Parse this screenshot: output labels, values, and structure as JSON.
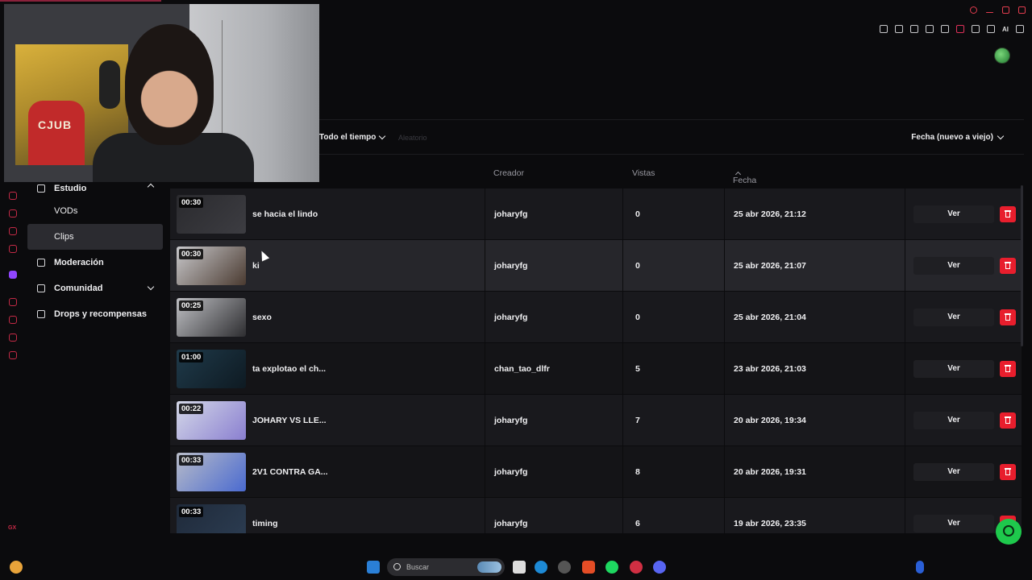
{
  "filters": {
    "date_range": "Todo el tiempo",
    "faded": "Aleatorio",
    "sort": "Fecha (nuevo a viejo)"
  },
  "nav": {
    "items": [
      {
        "label": "Estudio",
        "expanded": true
      },
      {
        "label": "VODs"
      },
      {
        "label": "Clips",
        "active": true
      },
      {
        "label": "Moderación"
      },
      {
        "label": "Comunidad",
        "expanded": false
      },
      {
        "label": "Drops y recompensas"
      }
    ]
  },
  "table": {
    "headers": {
      "creator": "Creador",
      "views": "Vistas",
      "date": "Fecha"
    },
    "rows": [
      {
        "duration": "00:30",
        "title": "se hacia el lindo",
        "creator": "joharyfg",
        "views": "0",
        "date": "25 abr 2026, 21:12",
        "action": "Ver",
        "thumb": [
          "#2a2a2e",
          "#3d3d42"
        ]
      },
      {
        "duration": "00:30",
        "title": "ki",
        "creator": "joharyfg",
        "views": "0",
        "date": "25 abr 2026, 21:07",
        "action": "Ver",
        "thumb": [
          "#c9c9cc",
          "#4a3a30"
        ]
      },
      {
        "duration": "00:25",
        "title": "sexo",
        "creator": "joharyfg",
        "views": "0",
        "date": "25 abr 2026, 21:04",
        "action": "Ver",
        "thumb": [
          "#bfc0c4",
          "#2d2d30"
        ]
      },
      {
        "duration": "01:00",
        "title": "ta explotao el ch...",
        "creator": "chan_tao_dlfr",
        "views": "5",
        "date": "23 abr 2026, 21:03",
        "action": "Ver",
        "thumb": [
          "#1f3a4a",
          "#0e1a22"
        ]
      },
      {
        "duration": "00:22",
        "title": "JOHARY VS LLE...",
        "creator": "joharyfg",
        "views": "7",
        "date": "20 abr 2026, 19:34",
        "action": "Ver",
        "thumb": [
          "#d4d8e8",
          "#8a7fd0"
        ]
      },
      {
        "duration": "00:33",
        "title": "2V1 CONTRA GA...",
        "creator": "joharyfg",
        "views": "8",
        "date": "20 abr 2026, 19:31",
        "action": "Ver",
        "thumb": [
          "#b8bcc8",
          "#4a6ad0"
        ]
      },
      {
        "duration": "00:33",
        "title": "timing",
        "creator": "joharyfg",
        "views": "6",
        "date": "19 abr 2026, 23:35",
        "action": "Ver",
        "thumb": [
          "#1f2a3a",
          "#2c3d52"
        ]
      }
    ]
  },
  "webcam": {
    "jersey_text": "CJUB"
  },
  "toolbar": {
    "ai_label": "AI"
  },
  "taskbar": {
    "search_placeholder": "Buscar"
  },
  "colors": {
    "accent": "#e0315a",
    "danger": "#e81e2d",
    "help": "#1ec94c"
  }
}
